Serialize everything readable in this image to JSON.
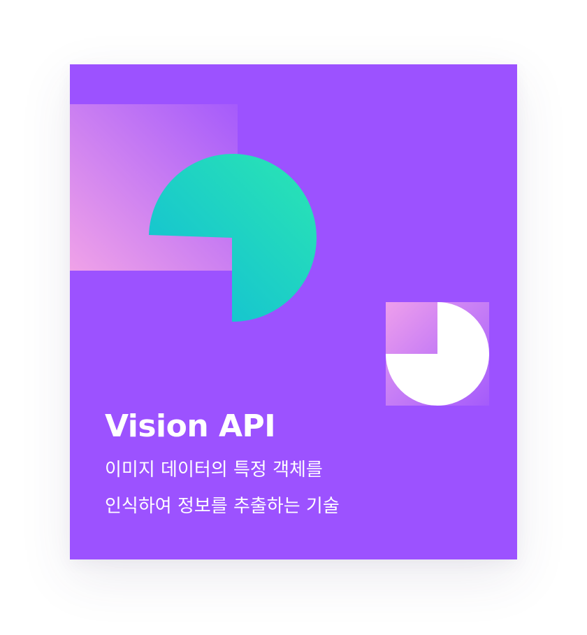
{
  "card": {
    "title": "Vision API",
    "description_lines": [
      "이미지 데이터의 특정 객체를",
      "인식하여 정보를 추출하는 기술"
    ]
  },
  "colors": {
    "page_background": "#ffffff",
    "card_background": "#9c52ff",
    "pink": "#f0a0e8",
    "teal": "#25e2b4",
    "cyan": "#18c6d2",
    "white": "#ffffff"
  }
}
